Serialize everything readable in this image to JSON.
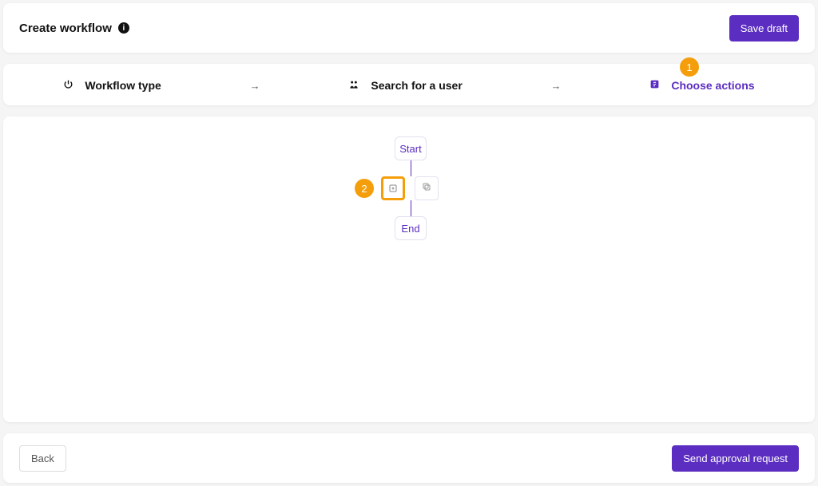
{
  "header": {
    "title": "Create workflow",
    "save_draft_label": "Save draft"
  },
  "steps": {
    "type_label": "Workflow type",
    "search_label": "Search for a user",
    "actions_label": "Choose actions",
    "active_step": "actions"
  },
  "workflow": {
    "start_label": "Start",
    "end_label": "End"
  },
  "footer": {
    "back_label": "Back",
    "submit_label": "Send approval request"
  },
  "callouts": {
    "c1": "1",
    "c2": "2"
  },
  "colors": {
    "primary": "#5b2dc1",
    "accent": "#f59e0b"
  }
}
